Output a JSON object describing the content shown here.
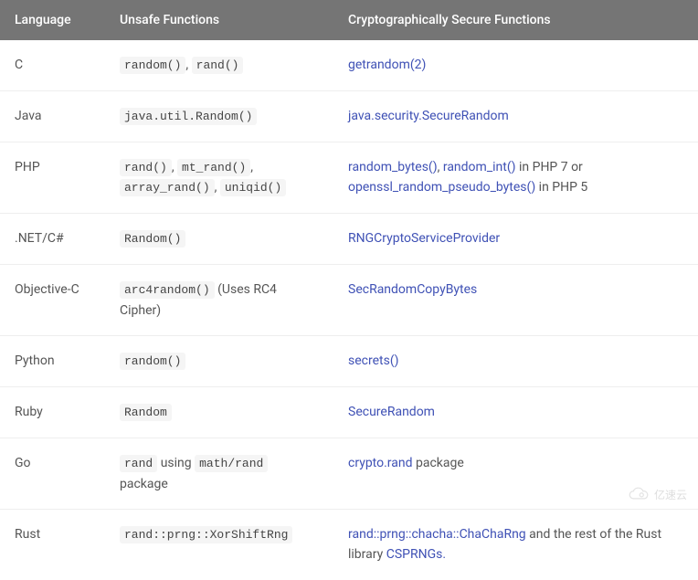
{
  "headers": {
    "language": "Language",
    "unsafe": "Unsafe Functions",
    "secure": "Cryptographically Secure Functions"
  },
  "rows": {
    "c": {
      "lang": "C",
      "unsafe_code1": "random()",
      "unsafe_sep": ", ",
      "unsafe_code2": "rand()",
      "secure_link1": "getrandom(2)"
    },
    "java": {
      "lang": "Java",
      "unsafe_code1": "java.util.Random()",
      "secure_link1": "java.security.SecureRandom"
    },
    "php": {
      "lang": "PHP",
      "unsafe_code1": "rand()",
      "unsafe_sep1": ", ",
      "unsafe_code2": "mt_rand()",
      "unsafe_sep2": ", ",
      "unsafe_code3": "array_rand()",
      "unsafe_sep3": ", ",
      "unsafe_code4": "uniqid()",
      "secure_link1": "random_bytes()",
      "secure_sep1": ", ",
      "secure_link2": "random_int()",
      "secure_text1": " in PHP 7 or ",
      "secure_link3": "openssl_random_pseudo_bytes()",
      "secure_text2": " in PHP 5"
    },
    "dotnet": {
      "lang": ".NET/C#",
      "unsafe_code1": "Random()",
      "secure_link1": "RNGCryptoServiceProvider"
    },
    "objc": {
      "lang": "Objective-C",
      "unsafe_code1": "arc4random()",
      "unsafe_text1": " (Uses RC4 Cipher)",
      "secure_link1": "SecRandomCopyBytes"
    },
    "python": {
      "lang": "Python",
      "unsafe_code1": "random()",
      "secure_link1": "secrets()"
    },
    "ruby": {
      "lang": "Ruby",
      "unsafe_code1": "Random",
      "secure_link1": "SecureRandom"
    },
    "go": {
      "lang": "Go",
      "unsafe_code1": "rand",
      "unsafe_text1": " using ",
      "unsafe_code2": "math/rand",
      "unsafe_text2": " package",
      "secure_link1": "crypto.rand",
      "secure_text1": " package"
    },
    "rust": {
      "lang": "Rust",
      "unsafe_code1": "rand::prng::XorShiftRng",
      "secure_link1": "rand::prng::chacha::ChaChaRng",
      "secure_text1": " and the rest of the Rust library ",
      "secure_link2": "CSPRNGs."
    }
  },
  "watermark": "亿速云"
}
